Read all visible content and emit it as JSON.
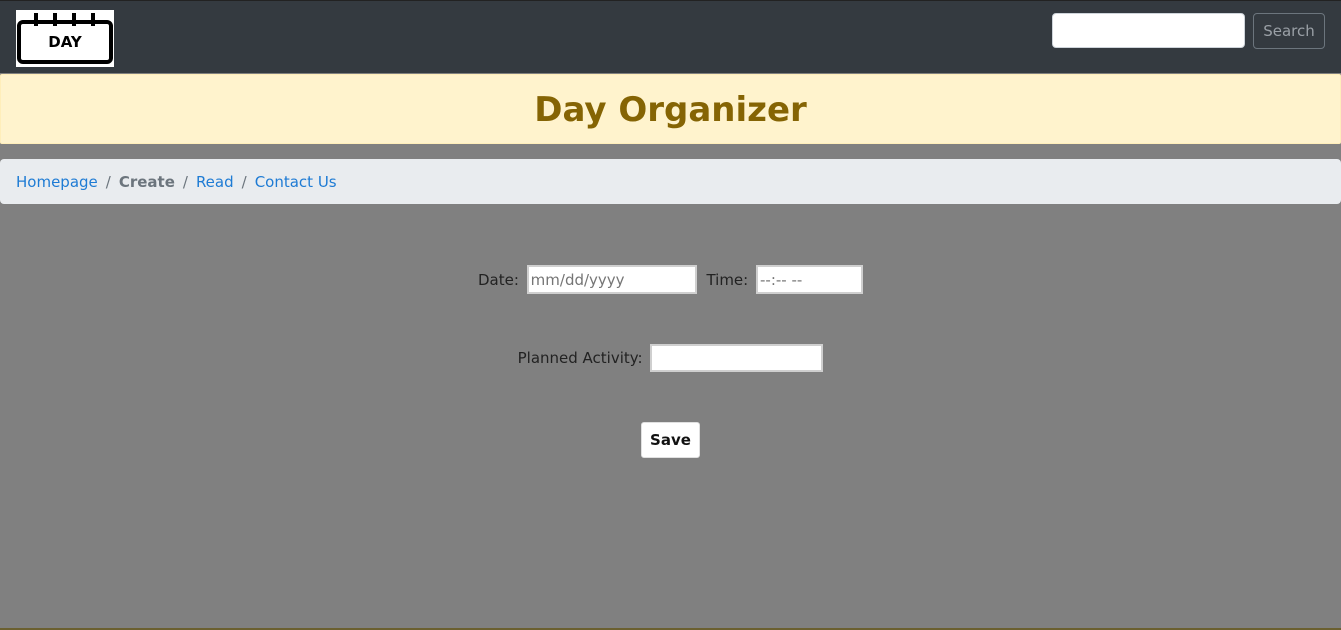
{
  "navbar": {
    "logo_text": "DAY",
    "search": {
      "placeholder": "",
      "value": ""
    },
    "search_button_label": "Search"
  },
  "banner": {
    "title": "Day Organizer"
  },
  "breadcrumb": {
    "items": [
      {
        "label": "Homepage",
        "active": false
      },
      {
        "label": "Create",
        "active": true
      },
      {
        "label": "Read",
        "active": false
      },
      {
        "label": "Contact Us",
        "active": false
      }
    ],
    "separator": "/"
  },
  "form": {
    "date_label": "Date:",
    "date_placeholder": "mm/dd/yyyy",
    "time_label": "Time:",
    "time_placeholder": "--:-- --",
    "activity_label": "Planned Activity:",
    "activity_value": "",
    "save_label": "Save"
  },
  "colors": {
    "navbar_bg": "#343a40",
    "banner_bg": "#fff3cd",
    "banner_text": "#856404",
    "breadcrumb_bg": "#e9ecef",
    "link": "#1e7bd4",
    "page_bg": "#808080"
  }
}
